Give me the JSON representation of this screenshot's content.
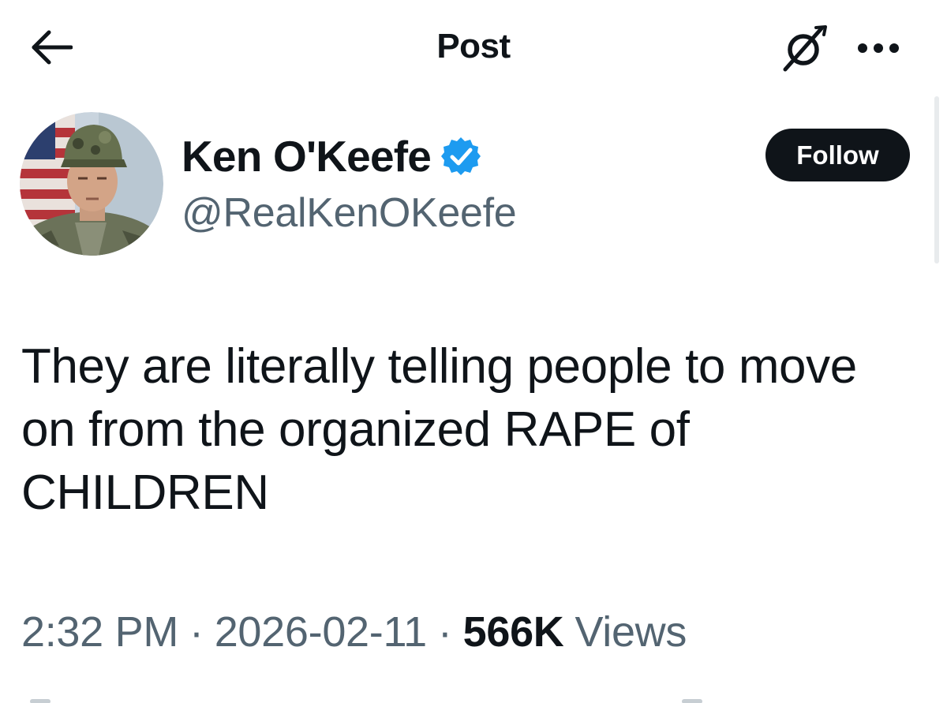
{
  "header": {
    "title": "Post",
    "back_icon": "arrow-left-icon",
    "grok_icon": "grok-slash-icon",
    "more_icon": "more-horizontal-icon"
  },
  "author": {
    "display_name": "Ken O'Keefe",
    "handle": "@RealKenOKeefe",
    "verified": true,
    "verified_color": "#1d9bf0",
    "follow_label": "Follow"
  },
  "post": {
    "text": "They are literally telling people to move on from the organized RAPE of CHILDREN"
  },
  "meta": {
    "time": "2:32 PM",
    "separator": "·",
    "date": "2026-02-11",
    "views_count": "566K",
    "views_label": "Views"
  },
  "colors": {
    "text_primary": "#0f1419",
    "text_secondary": "#536471",
    "follow_bg": "#0f1419",
    "follow_text": "#ffffff",
    "background": "#ffffff"
  }
}
